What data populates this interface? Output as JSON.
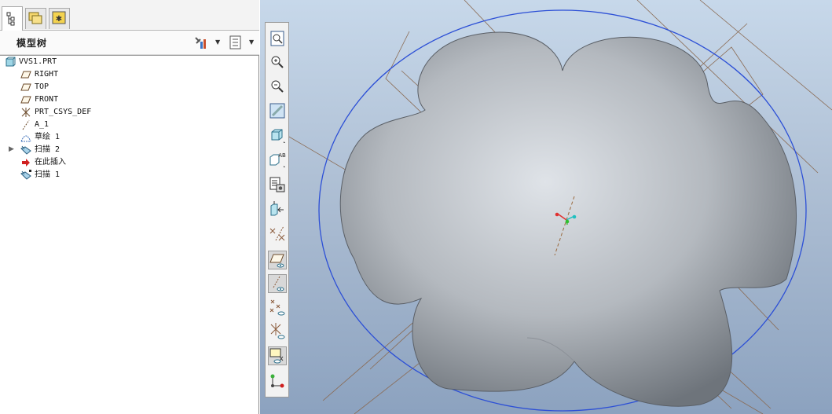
{
  "panel": {
    "title": "模型树"
  },
  "tabs": [
    {
      "name": "model-tree-tab-icon"
    },
    {
      "name": "folder-browser-tab-icon"
    },
    {
      "name": "favorites-tab-icon"
    }
  ],
  "tree": {
    "root": "VVS1.PRT",
    "items": [
      {
        "label": "RIGHT",
        "icon": "datum-plane-icon"
      },
      {
        "label": "TOP",
        "icon": "datum-plane-icon"
      },
      {
        "label": "FRONT",
        "icon": "datum-plane-icon"
      },
      {
        "label": "PRT_CSYS_DEF",
        "icon": "csys-icon"
      },
      {
        "label": "A_1",
        "icon": "datum-axis-icon"
      },
      {
        "label": "草绘 1",
        "icon": "sketch-icon"
      },
      {
        "label": "扫描 2",
        "icon": "sweep-icon"
      },
      {
        "label": "在此插入",
        "icon": "insert-here-arrow-icon"
      },
      {
        "label": "扫描 1",
        "icon": "sweep-icon"
      }
    ]
  },
  "toolbar": [
    "refit-icon",
    "zoom-in-icon",
    "zoom-out-icon",
    "repaint-icon",
    "shading-icon",
    "view-display-icon",
    "saved-views-icon",
    "view-manager-icon",
    "annotation-display-icon",
    "plane-display-icon",
    "axis-display-icon",
    "point-display-icon",
    "csys-display-icon",
    "spin-center-icon",
    "appearance-icon"
  ],
  "colors": {
    "accent": "#2c6fd1",
    "shape": "#b7bcc2",
    "datum": "#8a5a3a"
  }
}
